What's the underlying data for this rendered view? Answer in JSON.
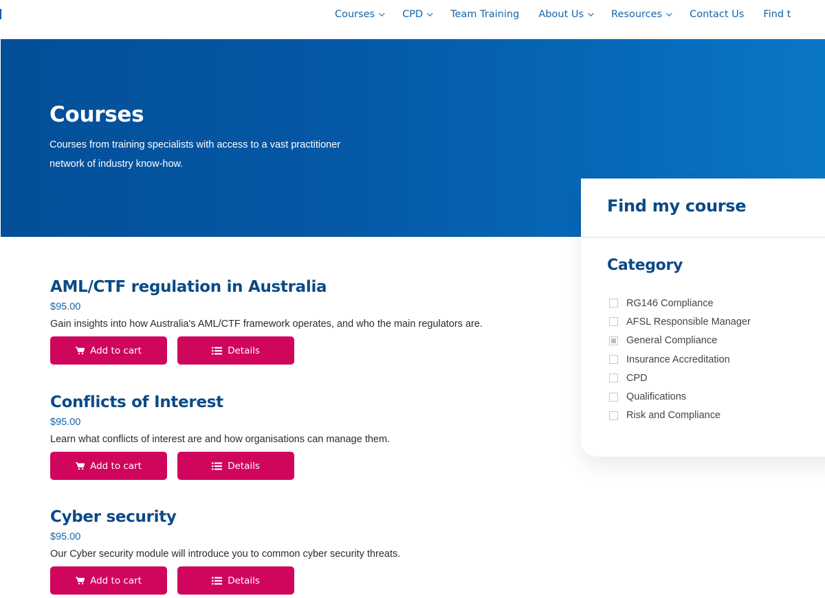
{
  "nav": {
    "items": [
      {
        "label": "Courses",
        "has_dropdown": true
      },
      {
        "label": "CPD",
        "has_dropdown": true
      },
      {
        "label": "Team Training",
        "has_dropdown": false
      },
      {
        "label": "About Us",
        "has_dropdown": true
      },
      {
        "label": "Resources",
        "has_dropdown": true
      },
      {
        "label": "Contact Us",
        "has_dropdown": false
      },
      {
        "label": "Find t",
        "has_dropdown": false
      }
    ]
  },
  "hero": {
    "title": "Courses",
    "subtitle_line1": "Courses from training specialists with access to a vast practitioner",
    "subtitle_line2": "network of industry know-how."
  },
  "courses": [
    {
      "title": "AML/CTF regulation in Australia",
      "price": "$95.00",
      "description": "Gain insights into how Australia's AML/CTF framework operates, and who the main regulators are.",
      "add_label": "Add to cart",
      "details_label": "Details"
    },
    {
      "title": "Conflicts of Interest",
      "price": "$95.00",
      "description": "Learn what conflicts of interest are and how organisations can manage them.",
      "add_label": "Add to cart",
      "details_label": "Details"
    },
    {
      "title": "Cyber security",
      "price": "$95.00",
      "description": "Our Cyber security module will introduce you to common cyber security threats.",
      "add_label": "Add to cart",
      "details_label": "Details"
    }
  ],
  "finder": {
    "title": "Find my course",
    "category_title": "Category",
    "categories": [
      {
        "label": "RG146 Compliance",
        "checked": false
      },
      {
        "label": "AFSL Responsible Manager",
        "checked": false
      },
      {
        "label": "General Compliance",
        "checked": true
      },
      {
        "label": "Insurance Accreditation",
        "checked": false
      },
      {
        "label": "CPD",
        "checked": false
      },
      {
        "label": "Qualifications",
        "checked": false
      },
      {
        "label": "Risk and Compliance",
        "checked": false
      }
    ]
  },
  "colors": {
    "brand_blue": "#0b4a86",
    "link_blue": "#1565a8",
    "hero_blue": "#0558a6",
    "button_pink": "#d0055c"
  },
  "icons": {
    "cart": "cart-icon",
    "details": "list-icon",
    "dropdown": "chevron-down-icon"
  }
}
